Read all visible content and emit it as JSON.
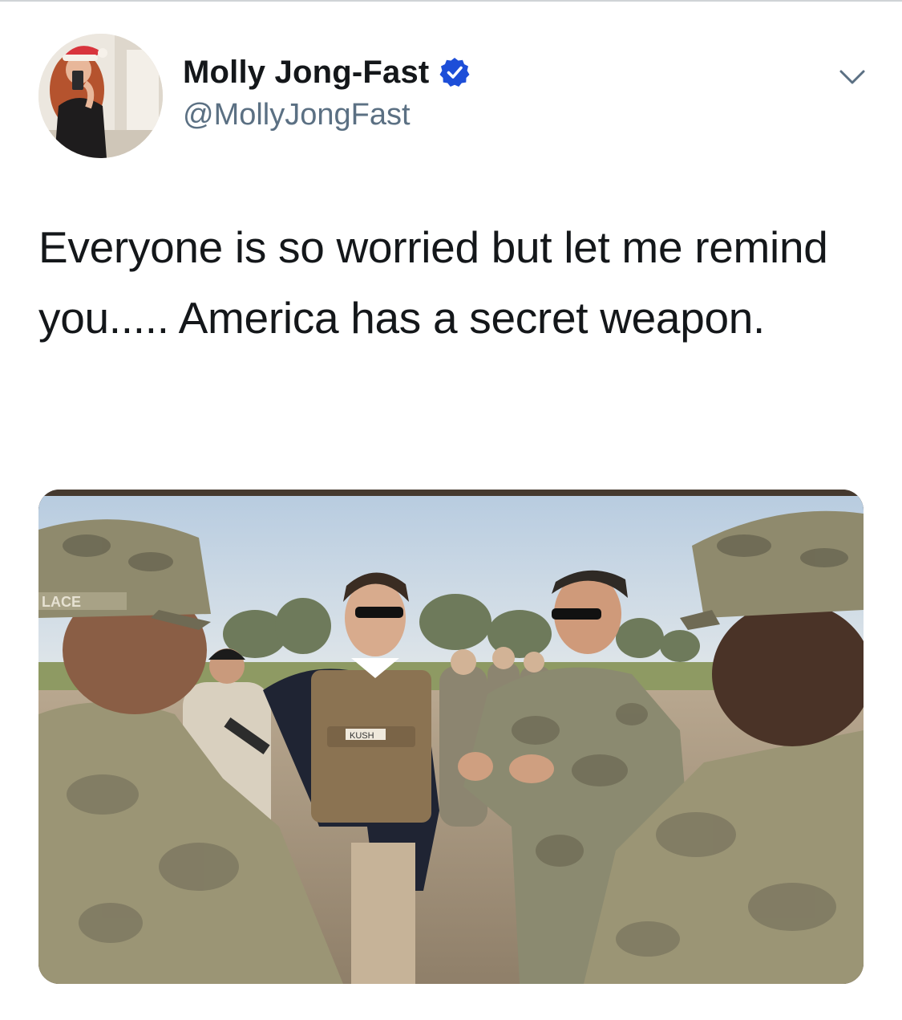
{
  "tweet": {
    "author": {
      "display_name": "Molly Jong-Fast",
      "handle": "@MollyJongFast",
      "verified": true,
      "avatar_icon": "profile-photo"
    },
    "text": "Everyone is so worried but let me remind you..... America has a secret weapon.",
    "menu_icon": "chevron-down-icon",
    "media": {
      "type": "photo",
      "vest_label": "KUSH",
      "cap_label": "LACE"
    }
  },
  "colors": {
    "text_primary": "#14171a",
    "text_secondary": "#5b7083",
    "verified_blue": "#1d4ed8",
    "divider": "#cfd3d6"
  }
}
